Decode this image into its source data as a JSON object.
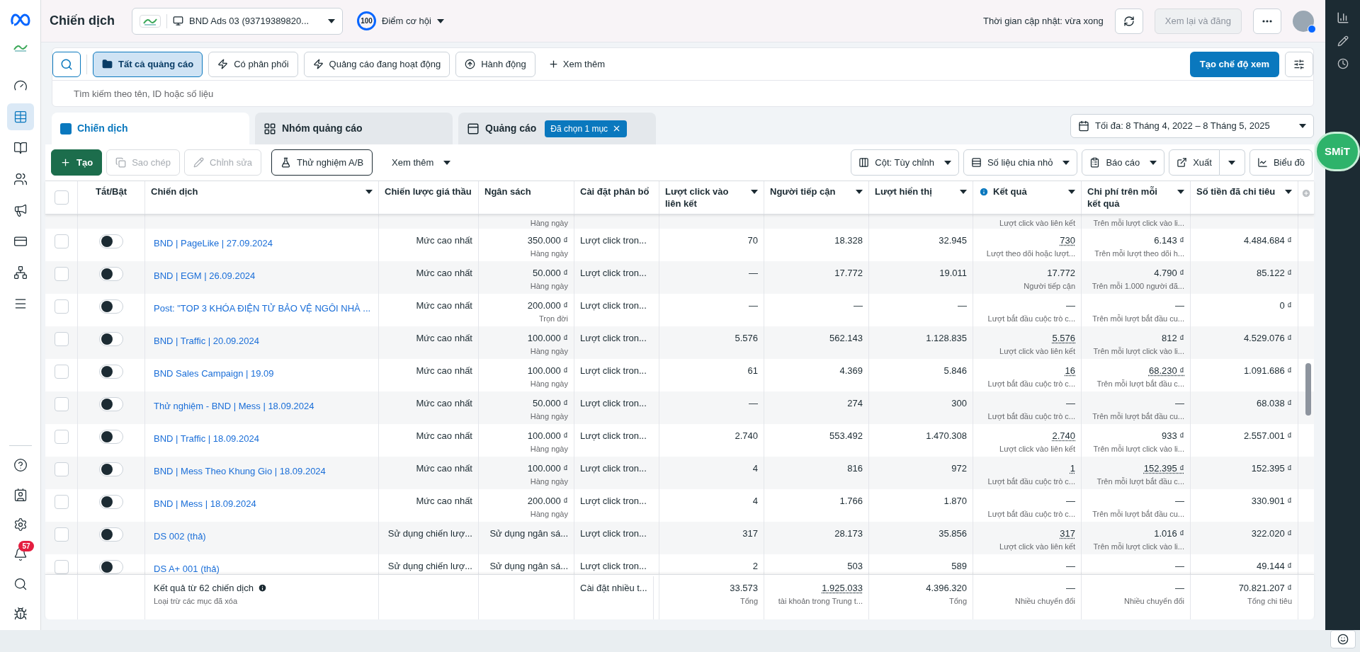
{
  "nav": {
    "top": [
      {
        "selected": false
      },
      {
        "selected": true
      },
      {
        "selected": false
      },
      {
        "selected": false
      },
      {
        "selected": false
      },
      {
        "selected": false
      },
      {
        "selected": false
      },
      {
        "selected": false
      }
    ],
    "bottom": [
      {
        "selected": false
      },
      {
        "selected": false
      },
      {
        "selected": false
      },
      {
        "selected": false,
        "badge": "57"
      },
      {
        "selected": false
      },
      {
        "selected": false
      }
    ]
  },
  "header": {
    "title": "Chiến dịch",
    "account": "BND Ads 03 (93719389820...",
    "score": "100",
    "score_label": "Điểm cơ hội",
    "updated": "Thời gian cập nhật: vừa xong",
    "review": {
      "label": "Xem lại và đăng",
      "disabled": true
    }
  },
  "filters": [
    {
      "label": "Tất cả quảng cáo",
      "selected": true
    },
    {
      "label": "Có phân phối",
      "selected": false
    },
    {
      "label": "Quảng cáo đang hoạt động",
      "selected": false
    },
    {
      "label": "Hành động",
      "selected": false
    }
  ],
  "more_filters": "Xem thêm",
  "create_view": "Tạo chế độ xem",
  "search": {
    "placeholder": "Tìm kiếm theo tên, ID hoặc số liệu"
  },
  "tabs": [
    {
      "label": "Chiến dịch",
      "selected": true
    },
    {
      "label": "Nhóm quảng cáo",
      "selected": false
    },
    {
      "label": "Quảng cáo",
      "selected": false,
      "chip": "Đã chọn 1 mục"
    }
  ],
  "date_range": "Tối đa: 8 Tháng 4, 2022 – 8 Tháng 5, 2025",
  "actions": [
    {
      "label": "Tạo",
      "kind": "primary",
      "disabled": false
    },
    {
      "label": "Sao chép",
      "kind": "outline",
      "disabled": true
    },
    {
      "label": "Chỉnh sửa",
      "kind": "outline",
      "disabled": true
    },
    {
      "label": "Thử nghiệm A/B",
      "kind": "outline",
      "disabled": false
    },
    {
      "label": "Xem thêm",
      "kind": "menu",
      "disabled": false
    }
  ],
  "view_actions": [
    {
      "label": "Cột: Tùy chỉnh",
      "kind": "menu"
    },
    {
      "label": "Số liệu chia nhỏ",
      "kind": "menu"
    },
    {
      "label": "Báo cáo",
      "kind": "menu"
    },
    {
      "label": "Xuất",
      "kind": "split"
    },
    {
      "label": "Biểu đồ",
      "kind": "plain"
    }
  ],
  "floating_badge": "SMiT",
  "table": {
    "select_all": {
      "checked": false
    },
    "columns": [
      {
        "label": "Tắt/Bật",
        "menu": false,
        "info": false
      },
      {
        "label": "Chiến dịch",
        "menu": true,
        "info": false
      },
      {
        "label": "Chiến lược giá thầu",
        "menu": false,
        "info": false
      },
      {
        "label": "Ngân sách",
        "menu": false,
        "info": false
      },
      {
        "label": "Cài đặt phân bổ",
        "menu": false,
        "info": false
      },
      {
        "label": "Lượt click vào liên kết",
        "menu": true,
        "info": false
      },
      {
        "label": "Người tiếp cận",
        "menu": true,
        "info": false
      },
      {
        "label": "Lượt hiển thị",
        "menu": true,
        "info": false
      },
      {
        "label": "Kết quả",
        "menu": true,
        "info": true
      },
      {
        "label": "Chi phí trên mỗi kết quả",
        "menu": true,
        "info": false
      },
      {
        "label": "Số tiền đã chi tiêu",
        "menu": true,
        "info": false
      }
    ],
    "partial_row": {
      "budget_note": "Hàng ngày",
      "result_note": "Lượt click vào liên kết",
      "cost_note": "Trên mỗi lượt click vào li..."
    },
    "rows": [
      {
        "checked": false,
        "on": false,
        "name": "BND | PageLike | 27.09.2024",
        "bid": "Mức cao nhất",
        "budget": "350.000 ₫",
        "budget_note": "Hàng ngày",
        "attribution": "Lượt click tron...",
        "clicks": "70",
        "reach": "18.328",
        "impressions": "32.945",
        "result": "730",
        "result_link": true,
        "result_note": "Lượt theo dõi hoặc lượt...",
        "cost": "6.143 ₫",
        "cost_link": false,
        "cost_note": "Trên mỗi lượt theo dõi h...",
        "spent": "4.484.684 ₫"
      },
      {
        "checked": false,
        "on": false,
        "name": "BND | EGM | 26.09.2024",
        "bid": "Mức cao nhất",
        "budget": "50.000 ₫",
        "budget_note": "Hàng ngày",
        "attribution": "Lượt click tron...",
        "clicks": "—",
        "reach": "17.772",
        "impressions": "19.011",
        "result": "17.772",
        "result_link": false,
        "result_note": "Người tiếp cận",
        "cost": "4.790 ₫",
        "cost_link": false,
        "cost_note": "Trên mỗi 1.000 người đã...",
        "spent": "85.122 ₫"
      },
      {
        "checked": false,
        "on": false,
        "name": "Post: \"TOP 3 KHÓA ĐIỆN TỬ BẢO VỆ NGÔI NHÀ ...",
        "bid": "Mức cao nhất",
        "budget": "200.000 ₫",
        "budget_note": "Trọn đời",
        "attribution": "Lượt click tron...",
        "clicks": "—",
        "reach": "—",
        "impressions": "—",
        "result": "—",
        "result_link": false,
        "result_note": "Lượt bắt đầu cuộc trò c...",
        "cost": "—",
        "cost_link": false,
        "cost_note": "Trên mỗi lượt bắt đầu cu...",
        "spent": "0 ₫"
      },
      {
        "checked": false,
        "on": false,
        "name": "BND | Traffic | 20.09.2024",
        "bid": "Mức cao nhất",
        "budget": "100.000 ₫",
        "budget_note": "Hàng ngày",
        "attribution": "Lượt click tron...",
        "clicks": "5.576",
        "reach": "562.143",
        "impressions": "1.128.835",
        "result": "5.576",
        "result_link": true,
        "result_note": "Lượt click vào liên kết",
        "cost": "812 ₫",
        "cost_link": false,
        "cost_note": "Trên mỗi lượt click vào li...",
        "spent": "4.529.076 ₫"
      },
      {
        "checked": false,
        "on": false,
        "name": "BND Sales Campaign | 19.09",
        "bid": "Mức cao nhất",
        "budget": "100.000 ₫",
        "budget_note": "Hàng ngày",
        "attribution": "Lượt click tron...",
        "clicks": "61",
        "reach": "4.369",
        "impressions": "5.846",
        "result": "16",
        "result_link": true,
        "result_note": "Lượt bắt đầu cuộc trò c...",
        "cost": "68.230 ₫",
        "cost_link": true,
        "cost_note": "Trên mỗi lượt bắt đầu c...",
        "spent": "1.091.686 ₫"
      },
      {
        "checked": false,
        "on": false,
        "name": "Thử nghiệm - BND | Mess | 18.09.2024",
        "bid": "Mức cao nhất",
        "budget": "50.000 ₫",
        "budget_note": "Hàng ngày",
        "attribution": "Lượt click tron...",
        "clicks": "—",
        "reach": "274",
        "impressions": "300",
        "result": "—",
        "result_link": false,
        "result_note": "Lượt bắt đầu cuộc trò c...",
        "cost": "—",
        "cost_link": false,
        "cost_note": "Trên mỗi lượt bắt đầu cu...",
        "spent": "68.038 ₫"
      },
      {
        "checked": false,
        "on": false,
        "name": "BND | Traffic | 18.09.2024",
        "bid": "Mức cao nhất",
        "budget": "100.000 ₫",
        "budget_note": "Hàng ngày",
        "attribution": "Lượt click tron...",
        "clicks": "2.740",
        "reach": "553.492",
        "impressions": "1.470.308",
        "result": "2.740",
        "result_link": true,
        "result_note": "Lượt click vào liên kết",
        "cost": "933 ₫",
        "cost_link": false,
        "cost_note": "Trên mỗi lượt click vào li...",
        "spent": "2.557.001 ₫"
      },
      {
        "checked": false,
        "on": false,
        "name": "BND | Mess Theo Khung Gio | 18.09.2024",
        "bid": "Mức cao nhất",
        "budget": "100.000 ₫",
        "budget_note": "Hàng ngày",
        "attribution": "Lượt click tron...",
        "clicks": "4",
        "reach": "816",
        "impressions": "972",
        "result": "1",
        "result_link": true,
        "result_note": "Lượt bắt đầu cuộc trò c...",
        "cost": "152.395 ₫",
        "cost_link": true,
        "cost_note": "Trên mỗi lượt bắt đầu c...",
        "spent": "152.395 ₫"
      },
      {
        "checked": false,
        "on": false,
        "name": "BND | Mess | 18.09.2024",
        "bid": "Mức cao nhất",
        "budget": "200.000 ₫",
        "budget_note": "Hàng ngày",
        "attribution": "Lượt click tron...",
        "clicks": "4",
        "reach": "1.766",
        "impressions": "1.870",
        "result": "—",
        "result_link": false,
        "result_note": "Lượt bắt đầu cuộc trò c...",
        "cost": "—",
        "cost_link": false,
        "cost_note": "Trên mỗi lượt bắt đầu cu...",
        "spent": "330.901 ₫"
      },
      {
        "checked": false,
        "on": false,
        "name": "DS 002 (thả)",
        "bid": "Sử dụng chiến lượ...",
        "budget": "Sử dụng ngân sá...",
        "attribution": "Lượt click tron...",
        "clicks": "317",
        "reach": "28.173",
        "impressions": "35.856",
        "result": "317",
        "result_link": true,
        "result_note": "Lượt click vào liên kết",
        "cost": "1.016 ₫",
        "cost_link": false,
        "cost_note": "Trên mỗi lượt click vào li...",
        "spent": "322.020 ₫"
      },
      {
        "checked": false,
        "on": false,
        "name": "DS A+ 001 (thả)",
        "bid": "Sử dụng chiến lượ...",
        "budget": "Sử dụng ngân sá...",
        "attribution": "Lượt click tron...",
        "clicks": "2",
        "reach": "503",
        "impressions": "589",
        "result": "—",
        "result_link": false,
        "cost": "—",
        "cost_link": false,
        "spent": "49.144 ₫"
      }
    ],
    "footer": {
      "title": "Kết quả từ 62 chiến dịch",
      "subtitle": "Loại trừ các mục đã xóa",
      "attribution": "Cài đặt nhiều t...",
      "clicks": "33.573",
      "clicks_note": "Tổng",
      "reach": "1.925.033",
      "reach_link": true,
      "reach_note": "tài khoản trong Trung t...",
      "impressions": "4.396.320",
      "impressions_note": "Tổng",
      "result": "—",
      "result_note": "Nhiều chuyển đổi",
      "cost": "—",
      "cost_note": "Nhiều chuyển đổi",
      "spent": "70.821.207 ₫",
      "spent_note": "Tổng chi tiêu"
    }
  }
}
